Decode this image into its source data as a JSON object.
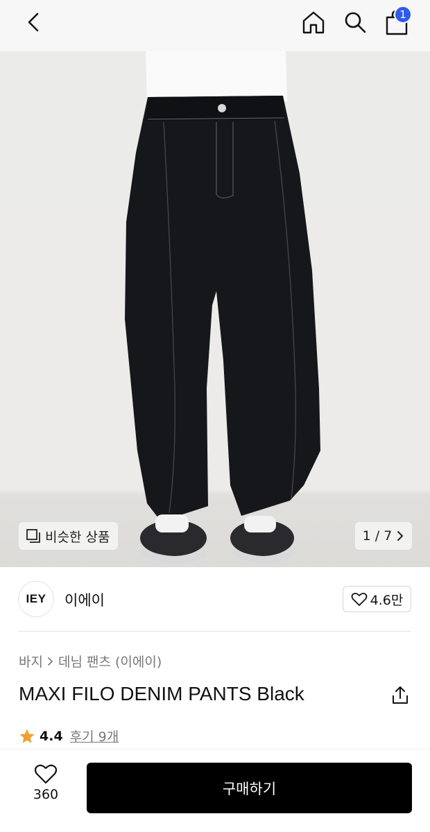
{
  "topbar": {
    "back_icon": "chevron-left-icon",
    "home_icon": "home-icon",
    "search_icon": "search-icon",
    "cart_icon": "shopping-bag-icon",
    "cart_count": "1",
    "badge_color": "#2f5bea"
  },
  "gallery": {
    "similar_label": "비슷한 상품",
    "similar_icon": "copy-icon",
    "page_indicator": "1 / 7",
    "pager_icon": "chevron-right-icon"
  },
  "brand": {
    "logo_text": "IEY",
    "name": "이에이",
    "likes": "4.6만",
    "like_icon": "heart-outline-icon"
  },
  "product": {
    "breadcrumb": [
      "바지",
      "데님 팬츠 (이에이)"
    ],
    "title": "MAXI FILO DENIM PANTS Black",
    "share_icon": "share-icon",
    "rating": "4.4",
    "review_link": "후기 9개",
    "star_color": "#f0a030"
  },
  "bottom": {
    "wish_count": "360",
    "wish_icon": "heart-outline-icon",
    "buy_label": "구매하기"
  }
}
